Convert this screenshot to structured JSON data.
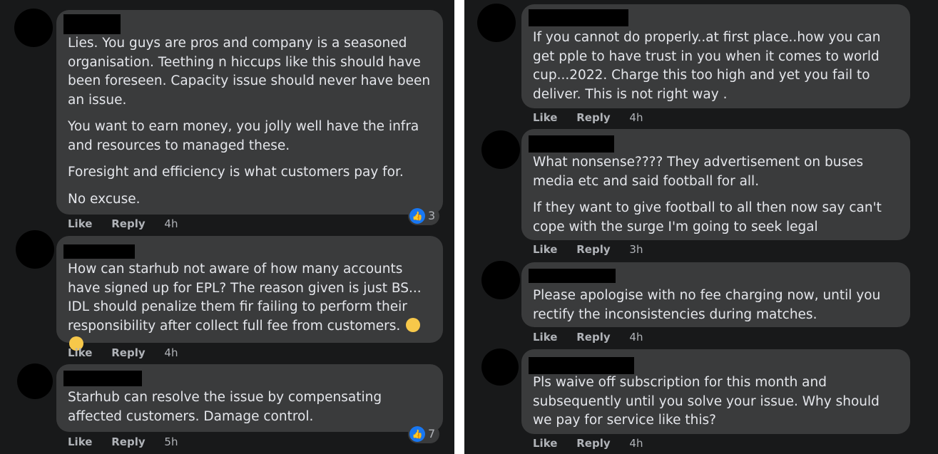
{
  "colors": {
    "background": "#18191a",
    "bubble": "#3a3b3c",
    "text": "#e4e6eb",
    "meta": "#b0b3b8",
    "like_blue": "#1877f2"
  },
  "labels": {
    "like": "Like",
    "reply": "Reply"
  },
  "left_comments": [
    {
      "paragraphs": [
        "Lies. You guys are pros and company is a seasoned organisation. Teething n hiccups like this should have been foreseen. Capacity issue should never have been an issue.",
        "You want to earn money, you jolly well have the infra and resources to managed these.",
        "Foresight and efficiency is what customers pay for.",
        "No excuse."
      ],
      "time": "4h",
      "reaction_icon": "like-icon",
      "reaction_count": "3"
    },
    {
      "paragraphs": [
        "How can starhub not aware of how many accounts have signed up for EPL? The reason given is just BS... IDL should penalize them fir failing to perform their responsibility after collect full fee from customers."
      ],
      "emoji": [
        "face-with-steam-icon",
        "face-with-steam-icon"
      ],
      "time": "4h"
    },
    {
      "paragraphs": [
        "Starhub can resolve the issue by compensating affected customers. Damage control."
      ],
      "time": "5h",
      "reaction_icon": "like-icon",
      "reaction_count": "7"
    }
  ],
  "right_comments": [
    {
      "paragraphs": [
        "If you cannot do properly..at first place..how you can get pple to have trust in you when it comes to world cup...2022. Charge this too high and yet you fail to deliver. This is not right way ."
      ],
      "time": "4h"
    },
    {
      "paragraphs": [
        "What nonsense???? They advertisement on buses media etc and said football for all.",
        "If they want to give football to all then now say can't cope with the surge I'm going to seek legal"
      ],
      "time": "3h"
    },
    {
      "paragraphs": [
        "Please apologise with no fee charging now, until you rectify the inconsistencies during matches."
      ],
      "time": "4h"
    },
    {
      "paragraphs": [
        "Pls waive off subscription for this month and subsequently until you solve your issue. Why should we pay for service like this?"
      ],
      "time": "4h"
    }
  ]
}
